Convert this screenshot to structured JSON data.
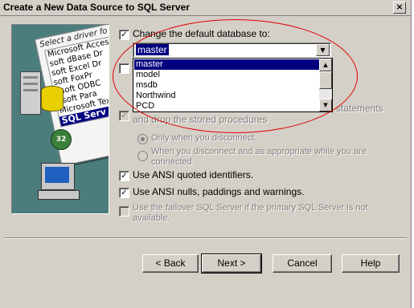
{
  "window": {
    "title": "Create a New Data Source to SQL Server",
    "close_glyph": "×"
  },
  "illustration": {
    "header": "Select a driver fo",
    "drivers": [
      "Microsoft Access D",
      "soft dBase Dr",
      "soft Excel Dr",
      "soft FoxPr",
      "osoft ODBC",
      "osoft Para",
      "Microsoft Tex",
      "SQL Serv"
    ],
    "badge": "32"
  },
  "options": {
    "change_default_db": {
      "label": "Change the default database to:",
      "checked": true
    },
    "database_combo": {
      "value": "master"
    },
    "database_list": [
      "master",
      "model",
      "msdb",
      "Northwind",
      "PCD"
    ],
    "create_temp_stored": {
      "label_tail": "statements",
      "label_line2": "and drop the stored procedures",
      "checked": false
    },
    "only_disconnect": {
      "label": "Only when you disconnect."
    },
    "when_disconnect": {
      "label_line1": "When you disconnect and as appropriate while you are",
      "label_line2": "connected"
    },
    "ansi_quoted": {
      "label": "Use ANSI quoted identifiers.",
      "checked": true
    },
    "ansi_nulls": {
      "label": "Use ANSI nulls, paddings and warnings.",
      "checked": true
    },
    "failover": {
      "label_line1": "Use the failover SQL Server if the primary SQL Server is not",
      "label_line2": "available.",
      "checked": false
    }
  },
  "buttons": {
    "back": "< Back",
    "next": "Next >",
    "cancel": "Cancel",
    "help": "Help"
  },
  "colors": {
    "accent": "#000080",
    "annotation": "#e00000",
    "dialog_bg": "#d4d0c8"
  }
}
